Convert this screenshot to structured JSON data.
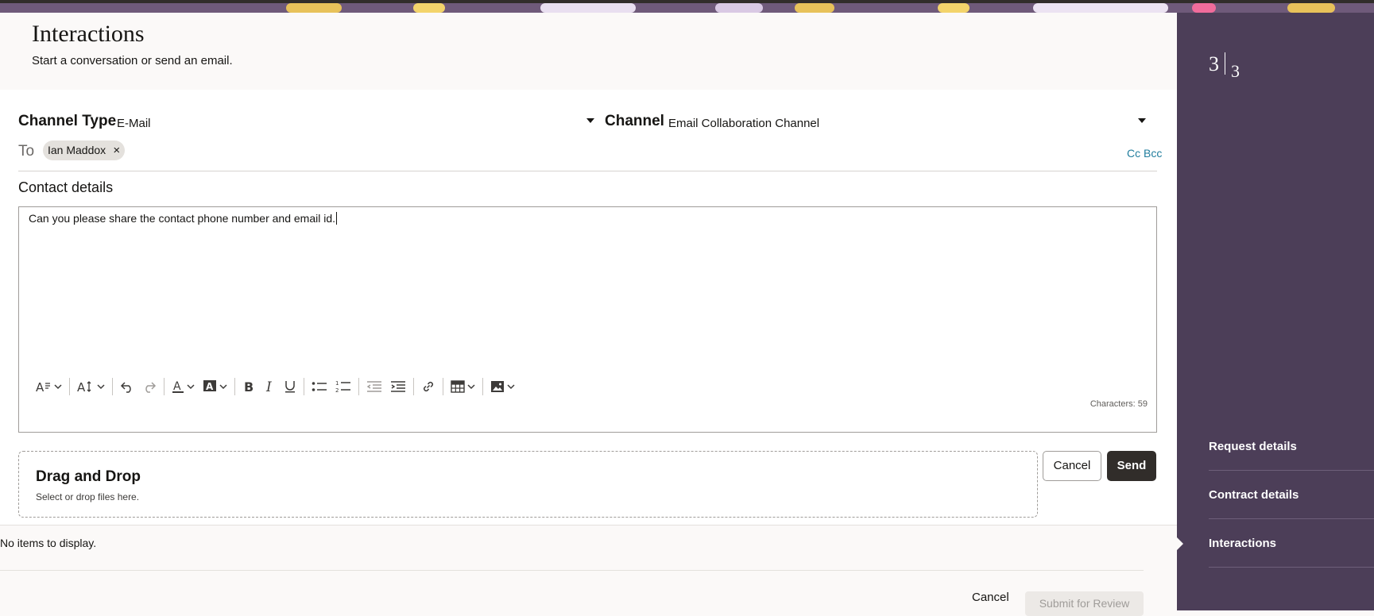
{
  "header": {
    "title": "Interactions",
    "subtitle": "Start a conversation or send an email."
  },
  "form": {
    "channel_type_label": "Channel Type",
    "channel_type_value": "E-Mail",
    "channel_label": "Channel",
    "channel_value": "Email Collaboration Channel",
    "to_label": "To",
    "recipients": [
      {
        "name": "Ian Maddox",
        "remove": "×"
      }
    ],
    "cc_bcc": "Cc Bcc",
    "subject": "Contact details",
    "body": "Can you please share the contact phone number and email id.",
    "char_count": "Characters: 59"
  },
  "toolbar_icons": [
    "format-icon",
    "font-size-icon",
    "undo-icon",
    "redo-icon",
    "font-color-icon",
    "highlight-icon",
    "bold-icon",
    "italic-icon",
    "underline-icon",
    "bullet-list-icon",
    "numbered-list-icon",
    "outdent-icon",
    "indent-icon",
    "link-icon",
    "table-icon",
    "image-icon"
  ],
  "dropzone": {
    "title": "Drag and Drop",
    "subtitle": "Select or drop files here."
  },
  "buttons": {
    "cancel": "Cancel",
    "send": "Send"
  },
  "list": {
    "empty": "No items to display."
  },
  "footer": {
    "cancel": "Cancel",
    "submit": "Submit for Review"
  },
  "side": {
    "step_current": "3",
    "step_total": "3",
    "nav": [
      {
        "label": "Request details"
      },
      {
        "label": "Contract details"
      },
      {
        "label": "Interactions"
      }
    ]
  },
  "colors": {
    "sidebar_bg": "#4c3e58",
    "primary_button": "#312d2a",
    "link": "#227e9e"
  }
}
